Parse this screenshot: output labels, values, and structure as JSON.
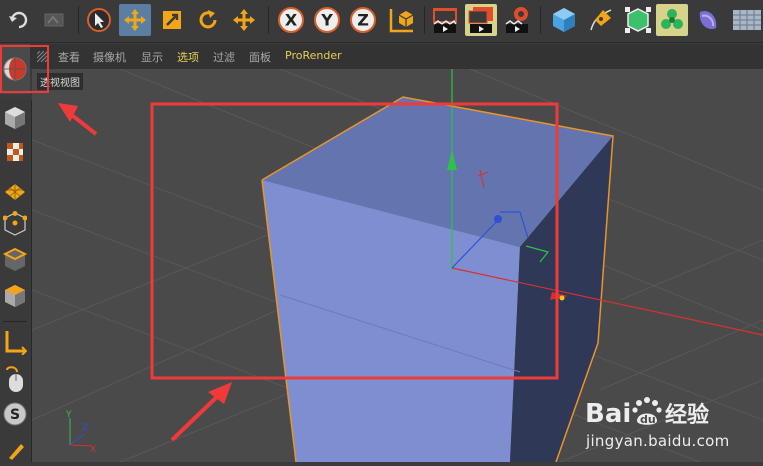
{
  "menu": {
    "items": [
      "查看",
      "摄像机",
      "显示",
      "选项",
      "过滤",
      "面板",
      "ProRender"
    ],
    "highlight_index": 3,
    "highlight_color": "#e8cf55"
  },
  "toolbar": {
    "icons": [
      "undo-icon",
      "redo-icon",
      "select-arrow-icon",
      "move-icon",
      "scale-icon",
      "rotate-icon",
      "live-select-icon",
      "x-axis-icon",
      "y-axis-icon",
      "z-axis-icon",
      "coordinate-system-icon",
      "render-view-icon",
      "render-picture-viewer-icon",
      "render-settings-icon",
      "cube-primitive-icon",
      "pen-spline-icon",
      "subdivision-icon",
      "cloner-icon",
      "deformer-icon",
      "floor-icon"
    ],
    "axis_x": "X",
    "axis_y": "Y",
    "axis_z": "Z"
  },
  "viewport": {
    "label": "透视视图",
    "axis_labels": {
      "y": "Y",
      "z": "Z",
      "x": "X"
    },
    "object_color": "#7d8fd0",
    "selection_outline_color": "#e8952a",
    "annotation_color": "#f03a3a"
  },
  "watermark": {
    "brand": "Bai du 经验",
    "url": "jingyan.baidu.com"
  }
}
